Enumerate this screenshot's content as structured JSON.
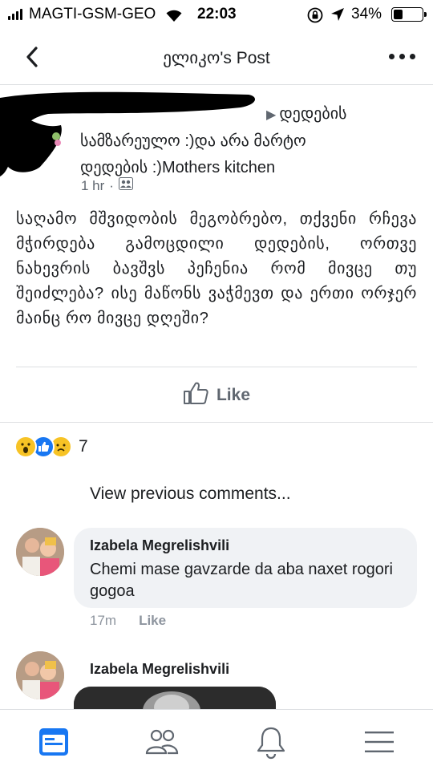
{
  "status_bar": {
    "carrier": "MAGTI-GSM-GEO",
    "time": "22:03",
    "battery_pct": "34%",
    "battery_level": 0.34
  },
  "header": {
    "title": "ელიკო's Post",
    "back_icon": "chevron-left-icon",
    "more_icon": "more-horizontal-icon"
  },
  "post": {
    "group_line_1": "დედების",
    "group_line_2": "სამზარეულო :)და არა მარტო",
    "group_line_3": "დედების :)Mothers kitchen",
    "time_ago": "1 hr",
    "meta_sep": "·",
    "audience_icon": "group-audience-icon",
    "body": "საღამო მშვიდობის მეგობრებო, თქვენი რჩევა მჭირდება გამოცდილი დედების, ორთვე ნახევრის ბავშვს პეჩენია  რომ მივცე თუ შეიძლება? ისე მაწონს ვაჭმევთ და ერთი ორჯერ მაინც რო მივცე დღეში?",
    "like_label": "Like"
  },
  "reactions": {
    "icons": [
      "wow-reaction-icon",
      "like-reaction-icon",
      "sad-reaction-icon"
    ],
    "count": "7"
  },
  "comments": {
    "view_previous": "View previous comments...",
    "items": [
      {
        "author": "Izabela Megrelishvili",
        "text": "Chemi mase gavzarde da aba naxet rogori gogoa",
        "time": "17m",
        "like_label": "Like"
      },
      {
        "author": "Izabela Megrelishvili"
      }
    ]
  },
  "tabbar": {
    "items": [
      "news-feed-icon",
      "friends-icon",
      "notifications-icon",
      "menu-icon"
    ],
    "active_color": "#1877f2",
    "inactive_color": "#606770"
  }
}
